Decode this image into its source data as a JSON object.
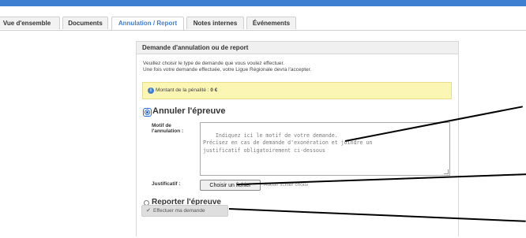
{
  "tabs": [
    {
      "label": "Vue d'ensemble",
      "active": false
    },
    {
      "label": "Documents",
      "active": false
    },
    {
      "label": "Annulation / Report",
      "active": true
    },
    {
      "label": "Notes internes",
      "active": false
    },
    {
      "label": "Événements",
      "active": false
    }
  ],
  "panel": {
    "title": "Demande d'annulation ou de report",
    "intro_line1": "Veuillez choisir le type de demande que vous voulez effectuer.",
    "intro_line2": "Une fois votre demande effectuée, votre Ligue Régionale devra l'accepter.",
    "penalty_text": "Montant de la pénalité : ",
    "penalty_value": "0 €",
    "option_cancel": "Annuler l'épreuve",
    "option_postpone": "Reporter l'épreuve",
    "selected_option": "cancel",
    "reason_label_line1": "Motif de",
    "reason_label_line2": "l'annulation :",
    "reason_placeholder": "Indiquez ici le motif de votre demande.\nPrécisez en cas de demande d'exonération et joindre un\njustificatif obligatoirement ci-dessous",
    "file_label": "Justificatif :",
    "file_button": "Choisir un fichier",
    "file_none": "Aucun fichier choisi",
    "submit_label": "Effectuer ma demande"
  },
  "colors": {
    "brand": "#3f7fd1",
    "alert_bg": "#fcf6b5",
    "annotation": "#000000"
  },
  "icons": {
    "info": "info-circle-icon",
    "submit": "checkmark-icon"
  }
}
